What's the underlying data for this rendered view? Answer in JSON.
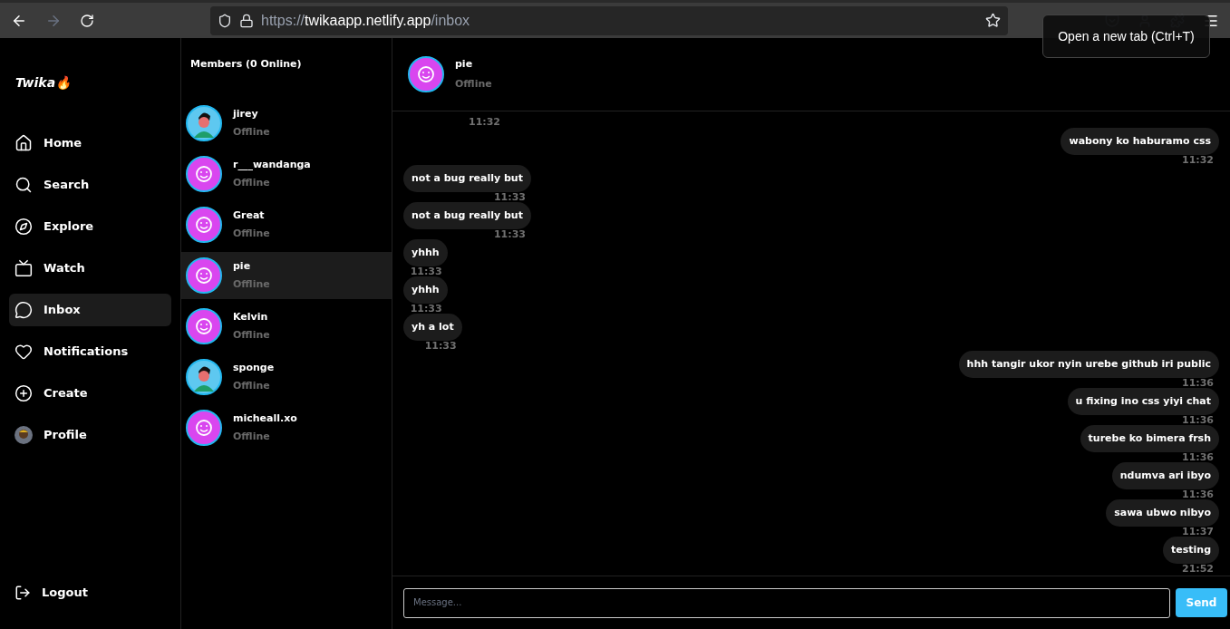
{
  "browser": {
    "url": {
      "scheme": "https://",
      "host": "twikaapp.netlify.app",
      "path": "/inbox"
    },
    "tooltip": "Open a new tab (Ctrl+T)"
  },
  "app": {
    "logo": "Twika",
    "logo_emoji": "🔥"
  },
  "nav": [
    {
      "label": "Home",
      "selected": false
    },
    {
      "label": "Search",
      "selected": false
    },
    {
      "label": "Explore",
      "selected": false
    },
    {
      "label": "Watch",
      "selected": false
    },
    {
      "label": "Inbox",
      "selected": true
    },
    {
      "label": "Notifications",
      "selected": false
    },
    {
      "label": "Create",
      "selected": false
    },
    {
      "label": "Profile",
      "selected": false
    }
  ],
  "logout": "Logout",
  "members": {
    "title": "Members (0 Online)",
    "items": [
      {
        "kind": "person",
        "name": "jirey",
        "status": "Offline",
        "selected": false
      },
      {
        "kind": "smiley",
        "name": "r___wandanga",
        "status": "Offline",
        "selected": false
      },
      {
        "kind": "smiley",
        "name": "Great",
        "status": "Offline",
        "selected": false
      },
      {
        "kind": "smiley",
        "name": "pie",
        "status": "Offline",
        "selected": true
      },
      {
        "kind": "smiley",
        "name": "Kelvin",
        "status": "Offline",
        "selected": false
      },
      {
        "kind": "person",
        "name": "sponge",
        "status": "Offline",
        "selected": false
      },
      {
        "kind": "smiley",
        "name": "micheall.xo",
        "status": "Offline",
        "selected": false
      }
    ]
  },
  "chat": {
    "name": "pie",
    "status": "Offline",
    "messages": [
      {
        "kind": "received",
        "time": "11:32"
      },
      {
        "kind": "sent",
        "text": "wabony ko haburamo css",
        "time": "11:32"
      },
      {
        "kind": "received",
        "text": "not a bug really but",
        "time": "11:33"
      },
      {
        "kind": "received",
        "text": "not a bug really but",
        "time": "11:33"
      },
      {
        "kind": "received",
        "text": "yhhh",
        "time": "11:33"
      },
      {
        "kind": "received",
        "text": "yhhh",
        "time": "11:33"
      },
      {
        "kind": "received",
        "text": "yh a lot",
        "time": "11:33"
      },
      {
        "kind": "sent",
        "text": "hhh tangir ukor nyin urebe github iri public",
        "time": "11:36"
      },
      {
        "kind": "sent",
        "text": "u fixing ino css yiyi chat",
        "time": "11:36"
      },
      {
        "kind": "sent",
        "text": "turebe ko bimera frsh",
        "time": "11:36"
      },
      {
        "kind": "sent",
        "text": "ndumva ari ibyo",
        "time": "11:36"
      },
      {
        "kind": "sent",
        "text": "sawa ubwo nibyo",
        "time": "11:37"
      },
      {
        "kind": "sent",
        "text": "testing",
        "time": "21:52"
      }
    ],
    "input": {
      "placeholder": "Message..."
    },
    "send": "Send"
  }
}
